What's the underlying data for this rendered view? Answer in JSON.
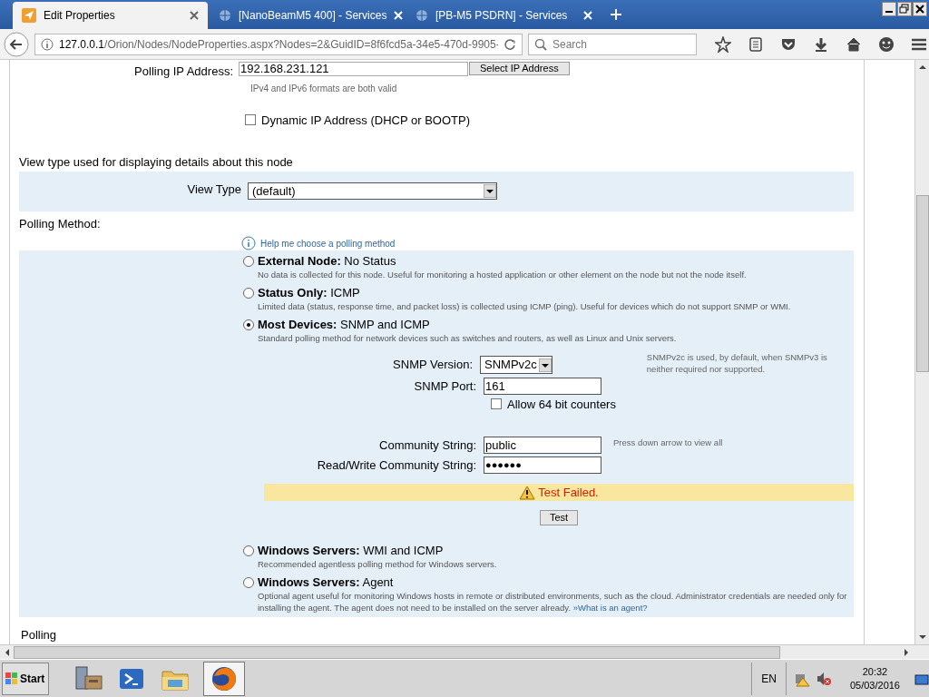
{
  "browser": {
    "tabs": [
      {
        "label": "Edit Properties",
        "selected": true
      },
      {
        "label": "[NanoBeamM5 400] - Services",
        "selected": false
      },
      {
        "label": "[PB-M5 PSDRN] - Services",
        "selected": false
      }
    ],
    "url": {
      "host": "127.0.0.1",
      "path": "/Orion/Nodes/NodeProperties.aspx?Nodes=2&GuidID=8f6fcd5a-34e5-470d-9905-"
    },
    "search": {
      "placeholder": "Search"
    }
  },
  "polling_ip": {
    "label": "Polling IP Address:",
    "value": "192.168.231.121",
    "button": "Select IP Address",
    "hint": "IPv4 and IPv6 formats are both valid"
  },
  "dynamic_ip": {
    "label": "Dynamic IP Address (DHCP or BOOTP)",
    "checked": false
  },
  "view_section": {
    "heading": "View type used for displaying details about this node",
    "label": "View Type",
    "value": "(default)"
  },
  "polling_method": {
    "heading": "Polling Method:",
    "help": "Help me choose a polling method",
    "options": [
      {
        "title": "External Node:",
        "subtitle": "No Status",
        "description": "No data is collected for this node. Useful for monitoring a hosted application or other element on the node but not the node itself.",
        "selected": false
      },
      {
        "title": "Status Only:",
        "subtitle": "ICMP",
        "description": "Limited data (status, response time, and packet loss) is collected using ICMP (ping). Useful for devices which do not support SNMP or WMI.",
        "selected": false
      },
      {
        "title": "Most Devices:",
        "subtitle": "SNMP and ICMP",
        "description": "Standard polling method for network devices such as switches and routers, as well as Linux and Unix servers.",
        "selected": true,
        "settings": {
          "version": {
            "label": "SNMP Version:",
            "value": "SNMPv2c"
          },
          "version_note": "SNMPv2c is used, by default, when SNMPv3 is neither required nor supported.",
          "port": {
            "label": "SNMP Port:",
            "value": "161"
          },
          "counters": {
            "label": "Allow 64 bit counters",
            "checked": false
          },
          "community": {
            "label": "Community String:",
            "value": "public",
            "note": "Press down arrow to view all"
          },
          "rw_community": {
            "label": "Read/Write Community String:",
            "value": "●●●●●●"
          },
          "test_result": "Test Failed.",
          "test_button": "Test"
        }
      },
      {
        "title": "Windows Servers:",
        "subtitle": "WMI and ICMP",
        "description": "Recommended agentless polling method for Windows servers.",
        "selected": false
      },
      {
        "title": "Windows Servers:",
        "subtitle": "Agent",
        "description": "Optional agent useful for monitoring Windows hosts in remote or distributed environments, such as the cloud. Administrator credentials are needed only for installing the agent. The agent does not need to be installed on the server already.",
        "link": "»What is an agent?",
        "selected": false
      }
    ]
  },
  "next_heading": "Polling",
  "taskbar": {
    "start": "Start",
    "language": "EN",
    "time": "20:32",
    "date": "05/03/2016"
  }
}
